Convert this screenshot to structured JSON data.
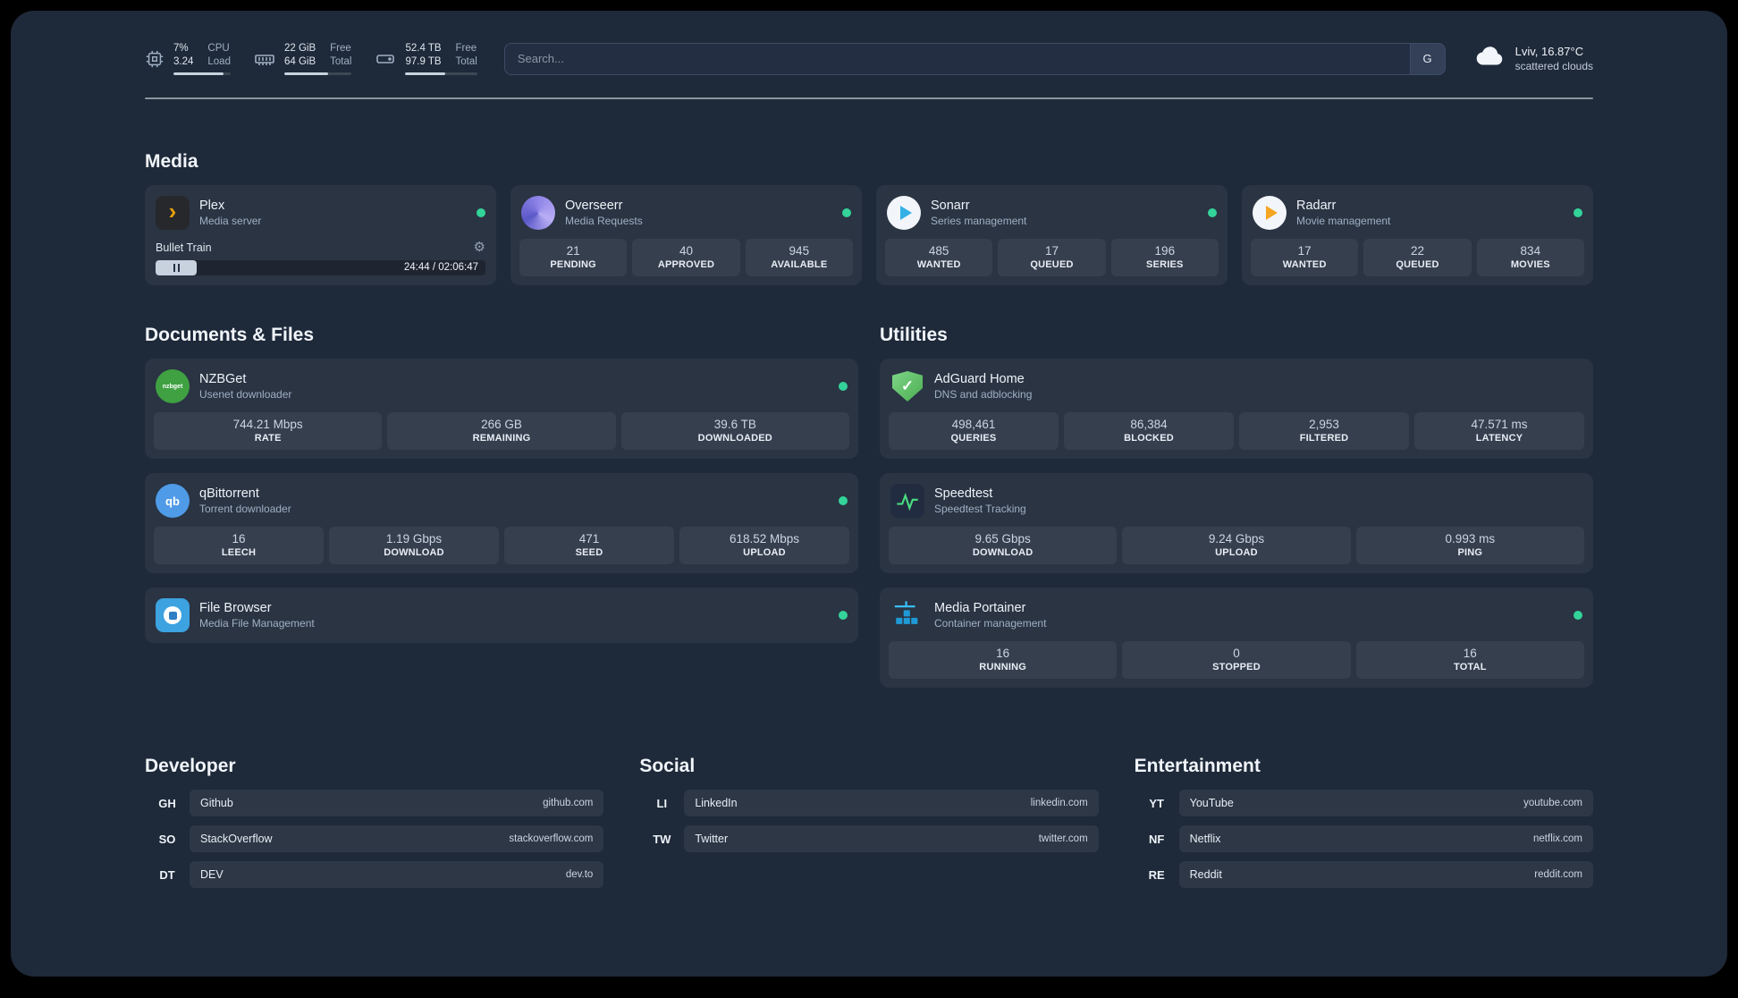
{
  "colors": {
    "status_online": "#34d399",
    "plex_amber": "#e5a00d",
    "background": "#1e2939"
  },
  "topbar": {
    "cpu": {
      "value1": "7%",
      "value2": "3.24",
      "label1": "CPU",
      "label2": "Load",
      "bar_style": "width:88%"
    },
    "memory": {
      "value1": "22 GiB",
      "value2": "64 GiB",
      "label1": "Free",
      "label2": "Total",
      "bar_style": "width:65%"
    },
    "disk": {
      "value1": "52.4 TB",
      "value2": "97.9 TB",
      "label1": "Free",
      "label2": "Total",
      "bar_style": "width:55%"
    },
    "search": {
      "placeholder": "Search...",
      "button_label": "G"
    },
    "weather": {
      "location": "Lviv, 16.87°C",
      "condition": "scattered clouds"
    }
  },
  "sections": {
    "media": {
      "title": "Media",
      "plex": {
        "name": "Plex",
        "desc": "Media server",
        "player": {
          "title": "Bullet Train",
          "time": "24:44 / 02:06:47"
        }
      },
      "overseerr": {
        "name": "Overseerr",
        "desc": "Media Requests",
        "stats": [
          {
            "value": "21",
            "label": "PENDING"
          },
          {
            "value": "40",
            "label": "APPROVED"
          },
          {
            "value": "945",
            "label": "AVAILABLE"
          }
        ]
      },
      "sonarr": {
        "name": "Sonarr",
        "desc": "Series management",
        "stats": [
          {
            "value": "485",
            "label": "WANTED"
          },
          {
            "value": "17",
            "label": "QUEUED"
          },
          {
            "value": "196",
            "label": "SERIES"
          }
        ]
      },
      "radarr": {
        "name": "Radarr",
        "desc": "Movie management",
        "stats": [
          {
            "value": "17",
            "label": "WANTED"
          },
          {
            "value": "22",
            "label": "QUEUED"
          },
          {
            "value": "834",
            "label": "MOVIES"
          }
        ]
      }
    },
    "documents": {
      "title": "Documents & Files",
      "nzbget": {
        "name": "NZBGet",
        "desc": "Usenet downloader",
        "stats": [
          {
            "value": "744.21 Mbps",
            "label": "RATE"
          },
          {
            "value": "266 GB",
            "label": "REMAINING"
          },
          {
            "value": "39.6 TB",
            "label": "DOWNLOADED"
          }
        ]
      },
      "qbittorrent": {
        "name": "qBittorrent",
        "desc": "Torrent downloader",
        "stats": [
          {
            "value": "16",
            "label": "LEECH"
          },
          {
            "value": "1.19 Gbps",
            "label": "DOWNLOAD"
          },
          {
            "value": "471",
            "label": "SEED"
          },
          {
            "value": "618.52 Mbps",
            "label": "UPLOAD"
          }
        ]
      },
      "filebrowser": {
        "name": "File Browser",
        "desc": "Media File Management"
      }
    },
    "utilities": {
      "title": "Utilities",
      "adguard": {
        "name": "AdGuard Home",
        "desc": "DNS and adblocking",
        "stats": [
          {
            "value": "498,461",
            "label": "QUERIES"
          },
          {
            "value": "86,384",
            "label": "BLOCKED"
          },
          {
            "value": "2,953",
            "label": "FILTERED"
          },
          {
            "value": "47.571 ms",
            "label": "LATENCY"
          }
        ]
      },
      "speedtest": {
        "name": "Speedtest",
        "desc": "Speedtest Tracking",
        "stats": [
          {
            "value": "9.65 Gbps",
            "label": "DOWNLOAD"
          },
          {
            "value": "9.24 Gbps",
            "label": "UPLOAD"
          },
          {
            "value": "0.993 ms",
            "label": "PING"
          }
        ]
      },
      "portainer": {
        "name": "Media Portainer",
        "desc": "Container management",
        "stats": [
          {
            "value": "16",
            "label": "RUNNING"
          },
          {
            "value": "0",
            "label": "STOPPED"
          },
          {
            "value": "16",
            "label": "TOTAL"
          }
        ]
      }
    },
    "bookmarks": {
      "developer": {
        "title": "Developer",
        "items": [
          {
            "abbr": "GH",
            "name": "Github",
            "domain": "github.com"
          },
          {
            "abbr": "SO",
            "name": "StackOverflow",
            "domain": "stackoverflow.com"
          },
          {
            "abbr": "DT",
            "name": "DEV",
            "domain": "dev.to"
          }
        ]
      },
      "social": {
        "title": "Social",
        "items": [
          {
            "abbr": "LI",
            "name": "LinkedIn",
            "domain": "linkedin.com"
          },
          {
            "abbr": "TW",
            "name": "Twitter",
            "domain": "twitter.com"
          }
        ]
      },
      "entertainment": {
        "title": "Entertainment",
        "items": [
          {
            "abbr": "YT",
            "name": "YouTube",
            "domain": "youtube.com"
          },
          {
            "abbr": "NF",
            "name": "Netflix",
            "domain": "netflix.com"
          },
          {
            "abbr": "RE",
            "name": "Reddit",
            "domain": "reddit.com"
          }
        ]
      }
    }
  },
  "icons": {
    "plex_glyph": "›",
    "nzbget_text": "nzbget",
    "qb_text": "qb",
    "adguard_check": "✓",
    "gear_glyph": "⚙"
  }
}
